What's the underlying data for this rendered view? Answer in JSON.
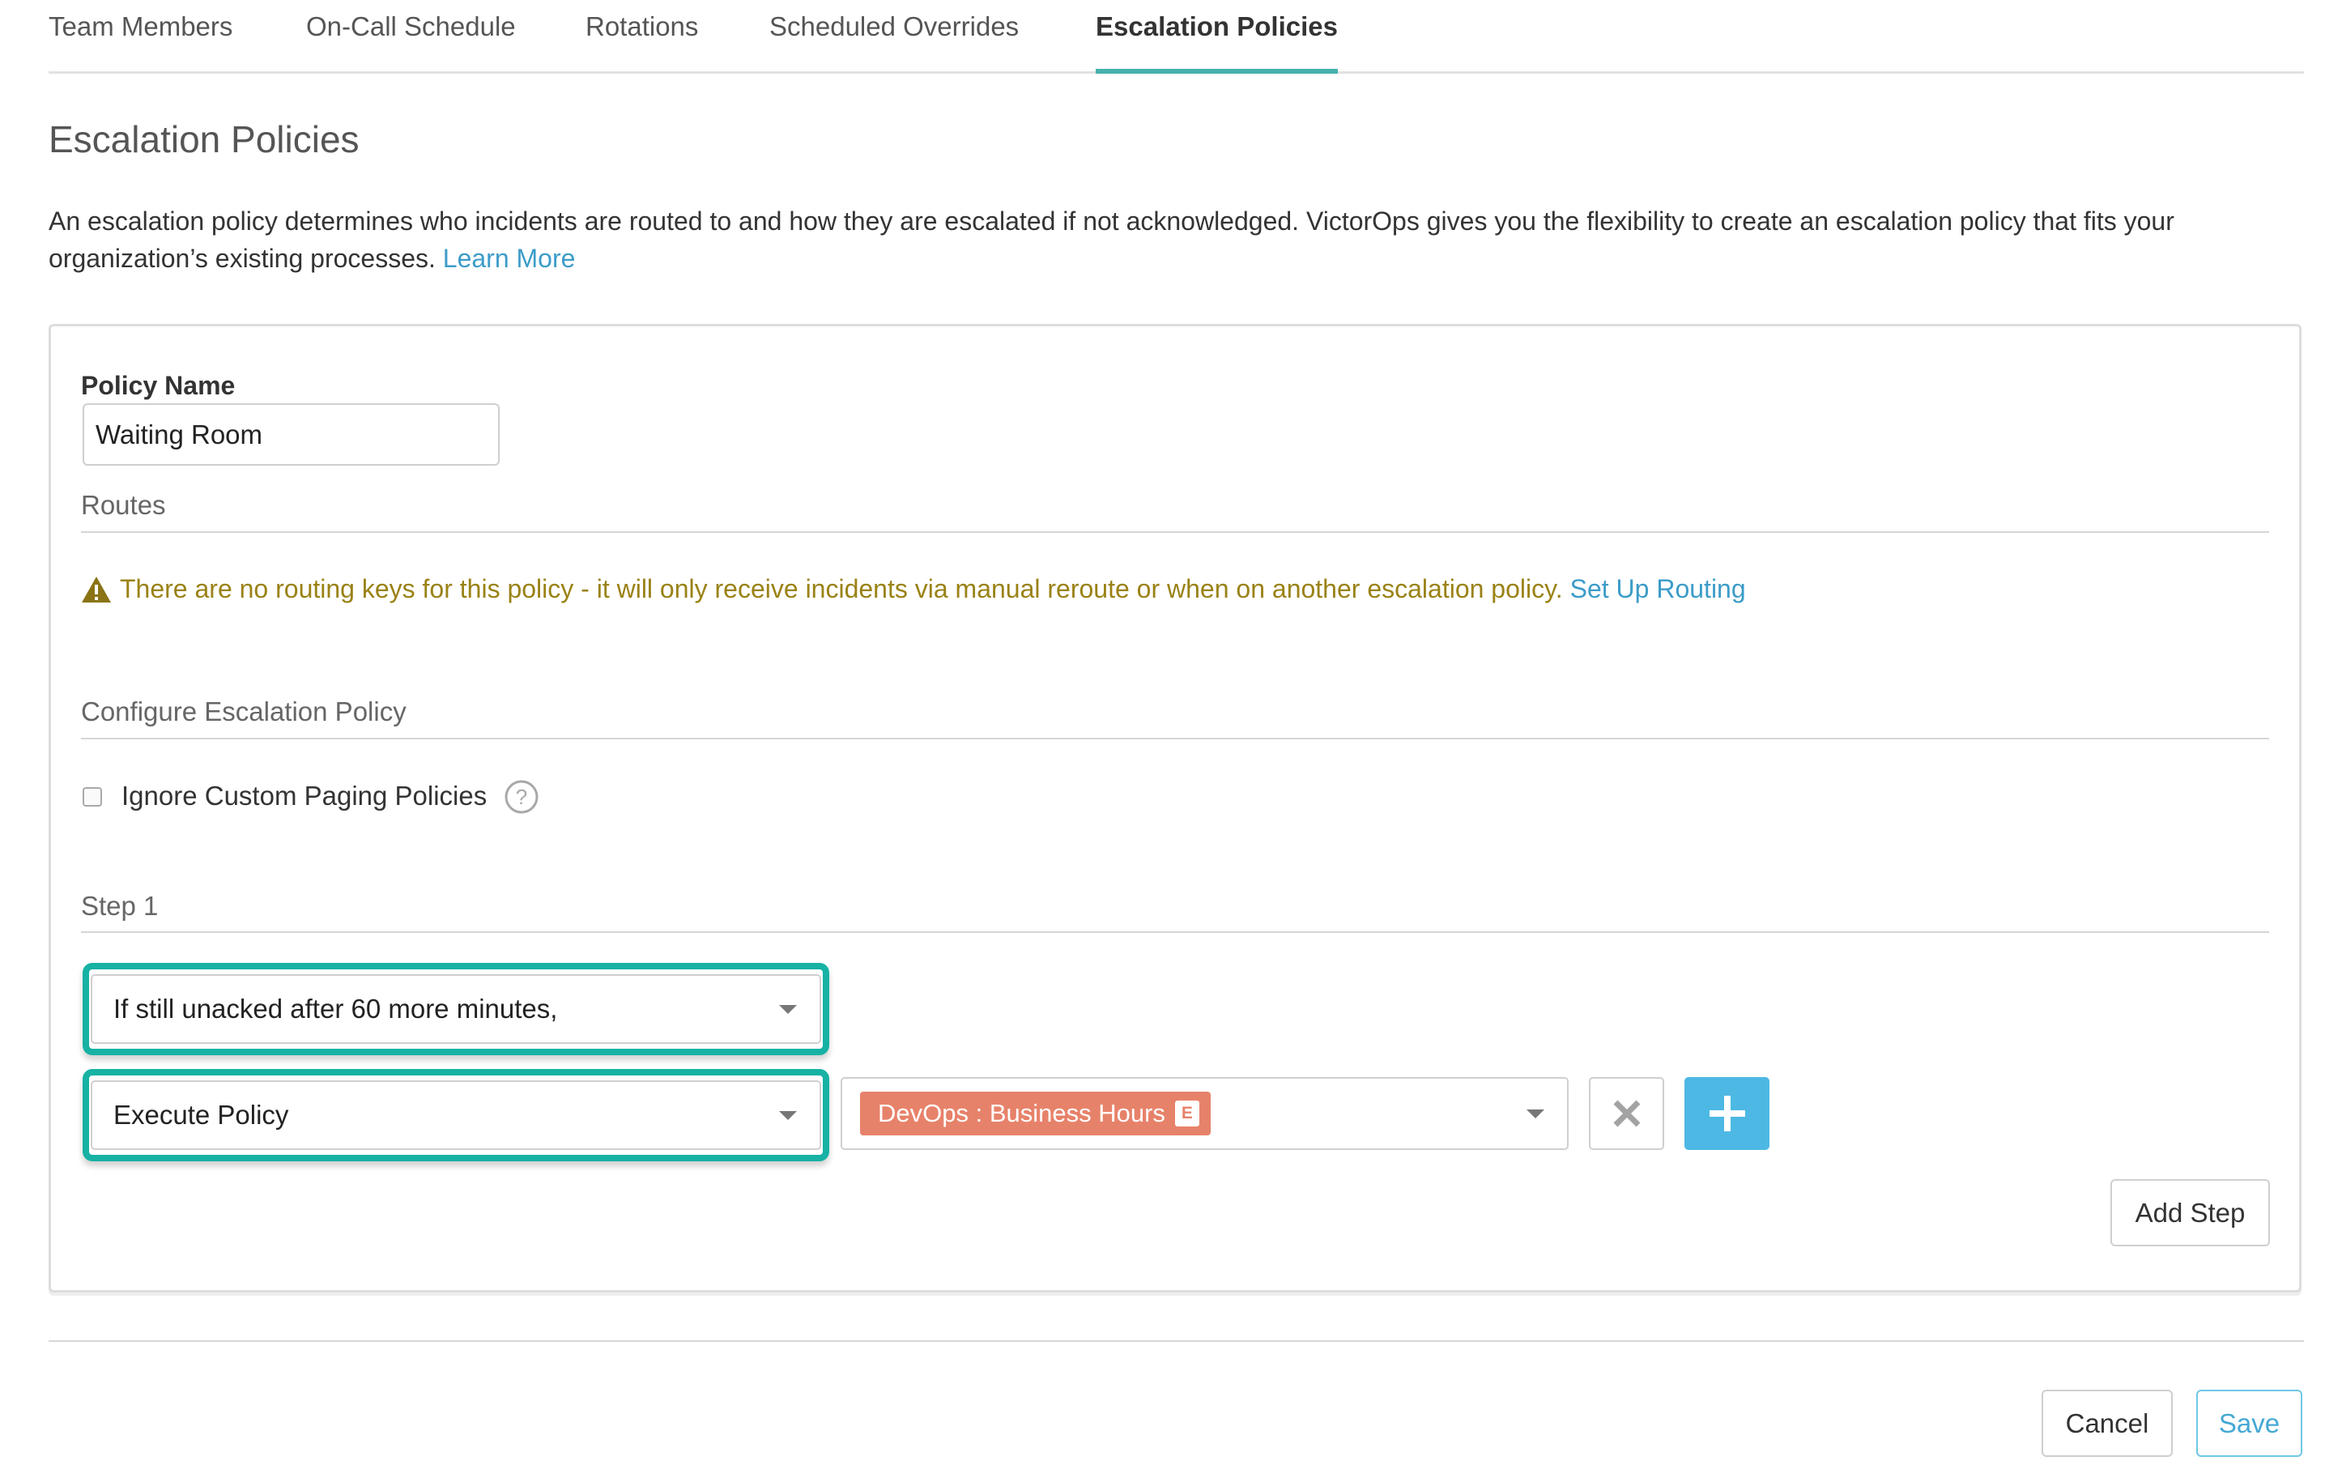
{
  "tabs": [
    {
      "label": "Team Members",
      "active": false
    },
    {
      "label": "On-Call Schedule",
      "active": false
    },
    {
      "label": "Rotations",
      "active": false
    },
    {
      "label": "Scheduled Overrides",
      "active": false
    },
    {
      "label": "Escalation Policies",
      "active": true
    }
  ],
  "page": {
    "title": "Escalation Policies",
    "intro_text": "An escalation policy determines who incidents are routed to and how they are escalated if not acknowledged. VictorOps gives you the flexibility to create an escalation policy that fits your organization’s existing processes.",
    "learn_more": "Learn More"
  },
  "form": {
    "policy_name_label": "Policy Name",
    "policy_name_value": "Waiting Room",
    "routes_label": "Routes",
    "routing_warning": "There are no routing keys for this policy - it will only receive incidents via manual reroute or when on another escalation policy.",
    "setup_routing_link": "Set Up Routing",
    "configure_label": "Configure Escalation Policy",
    "ignore_custom_paging_label": "Ignore Custom Paging Policies",
    "ignore_custom_paging_checked": false,
    "step_label": "Step 1",
    "timing_select_value": "If still unacked after 60 more minutes,",
    "action_select_value": "Execute Policy",
    "policy_tag": "DevOps : Business Hours",
    "policy_tag_badge": "E",
    "add_step_label": "Add Step"
  },
  "footer": {
    "cancel_label": "Cancel",
    "save_label": "Save"
  },
  "colors": {
    "accent_teal": "#45b1ad",
    "highlight_ring": "#17b2a4",
    "link_blue": "#3c9cc9",
    "warning_olive": "#9a8216",
    "tag_salmon": "#e7826a",
    "plus_button_blue": "#4db8e4"
  },
  "icons": {
    "warning": "warning-triangle-icon",
    "help": "question-circle-icon",
    "remove": "close-x-icon",
    "add": "plus-icon",
    "dropdown": "caret-down-icon"
  }
}
